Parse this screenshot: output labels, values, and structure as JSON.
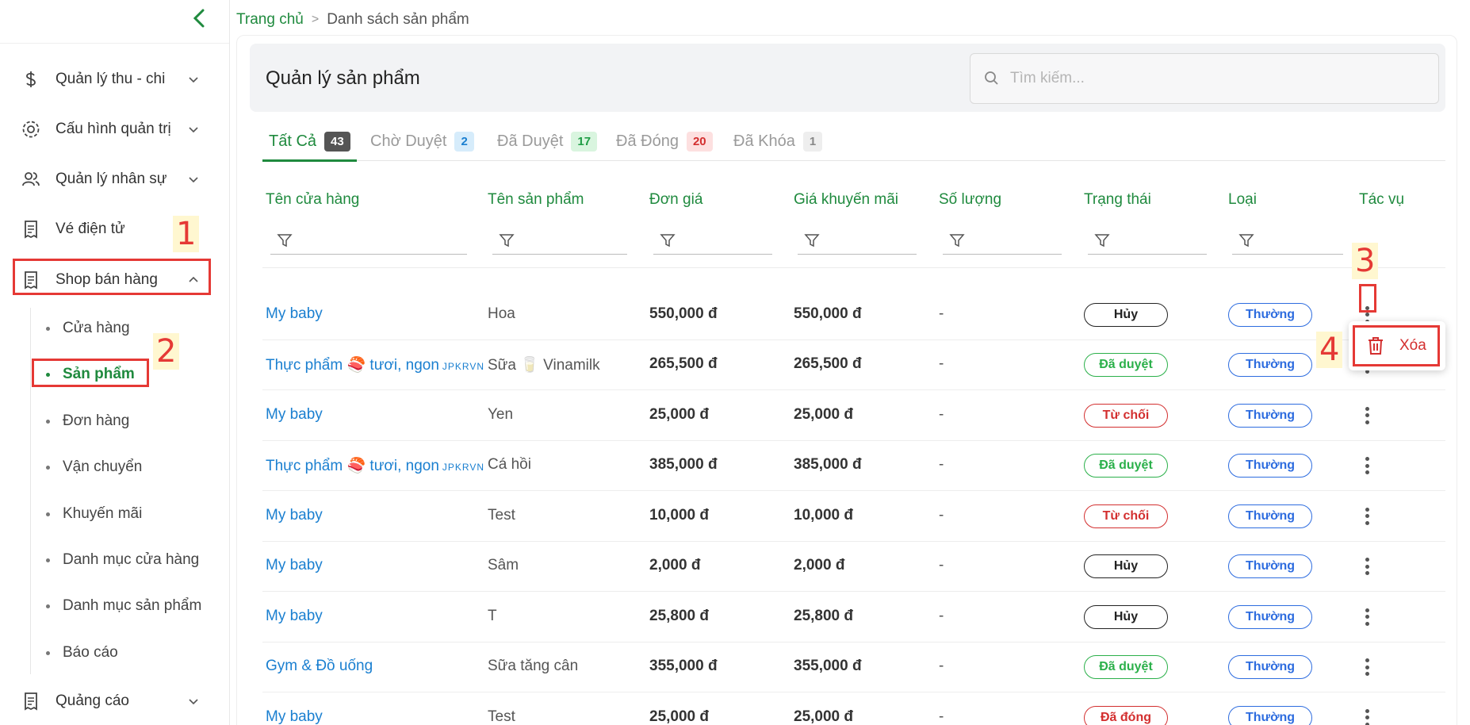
{
  "sidebar": {
    "items": [
      {
        "label": "Quản lý thu - chi",
        "icon": "dollar-icon"
      },
      {
        "label": "Cấu hình quản trị",
        "icon": "gear-icon"
      },
      {
        "label": "Quản lý nhân sự",
        "icon": "users-icon"
      },
      {
        "label": "Vé điện tử",
        "icon": "receipt-icon"
      },
      {
        "label": "Shop bán hàng",
        "icon": "receipt-icon"
      },
      {
        "label": "Quảng cáo",
        "icon": "receipt-icon"
      }
    ],
    "sub_items": [
      "Cửa hàng",
      "Sản phẩm",
      "Đơn hàng",
      "Vận chuyển",
      "Khuyến mãi",
      "Danh mục cửa hàng",
      "Danh mục sản phẩm",
      "Báo cáo"
    ],
    "active_sub": "Sản phẩm"
  },
  "breadcrumb": {
    "home": "Trang chủ",
    "separator": ">",
    "current": "Danh sách sản phẩm"
  },
  "header": {
    "title": "Quản lý sản phẩm",
    "search_placeholder": "Tìm kiếm..."
  },
  "tabs": [
    {
      "label": "Tất Cả",
      "count": "43",
      "active": true,
      "badge_bg": "#555555",
      "badge_fg": "#ffffff"
    },
    {
      "label": "Chờ Duyệt",
      "count": "2",
      "badge_bg": "#d6ecfb",
      "badge_fg": "#1a7fd0"
    },
    {
      "label": "Đã Duyệt",
      "count": "17",
      "badge_bg": "#d9f5df",
      "badge_fg": "#1f9d45"
    },
    {
      "label": "Đã Đóng",
      "count": "20",
      "badge_bg": "#fde0e0",
      "badge_fg": "#d32f2f"
    },
    {
      "label": "Đã Khóa",
      "count": "1",
      "badge_bg": "#eeeeee",
      "badge_fg": "#888888"
    }
  ],
  "columns": [
    "Tên cửa hàng",
    "Tên sản phẩm",
    "Đơn giá",
    "Giá khuyến mãi",
    "Số lượng",
    "Trạng thái",
    "Loại",
    "Tác vụ"
  ],
  "rows": [
    {
      "shop": "My baby",
      "shop_tag": "",
      "product": "Hoa",
      "price": "550,000 đ",
      "promo": "550,000 đ",
      "qty": "-",
      "status": "Hủy",
      "type": "Thường"
    },
    {
      "shop": "Thực phẩm 🍣 tươi, ngon",
      "shop_tag": "JPKRVN",
      "product": "Sữa 🥛 Vinamilk",
      "price": "265,500 đ",
      "promo": "265,500 đ",
      "qty": "-",
      "status": "Đã duyệt",
      "type": "Thường"
    },
    {
      "shop": "My baby",
      "shop_tag": "",
      "product": "Yen",
      "price": "25,000 đ",
      "promo": "25,000 đ",
      "qty": "-",
      "status": "Từ chối",
      "type": "Thường"
    },
    {
      "shop": "Thực phẩm 🍣 tươi, ngon",
      "shop_tag": "JPKRVN",
      "product": "Cá hồi",
      "price": "385,000 đ",
      "promo": "385,000 đ",
      "qty": "-",
      "status": "Đã duyệt",
      "type": "Thường"
    },
    {
      "shop": "My baby",
      "shop_tag": "",
      "product": "Test",
      "price": "10,000 đ",
      "promo": "10,000 đ",
      "qty": "-",
      "status": "Từ chối",
      "type": "Thường"
    },
    {
      "shop": "My baby",
      "shop_tag": "",
      "product": "Sâm",
      "price": "2,000 đ",
      "promo": "2,000 đ",
      "qty": "-",
      "status": "Hủy",
      "type": "Thường"
    },
    {
      "shop": "My baby",
      "shop_tag": "",
      "product": "T",
      "price": "25,800 đ",
      "promo": "25,800 đ",
      "qty": "-",
      "status": "Hủy",
      "type": "Thường"
    },
    {
      "shop": "Gym & Đồ uống",
      "shop_tag": "",
      "product": "Sữa tăng cân",
      "price": "355,000 đ",
      "promo": "355,000 đ",
      "qty": "-",
      "status": "Đã duyệt",
      "type": "Thường"
    },
    {
      "shop": "My baby",
      "shop_tag": "",
      "product": "Test",
      "price": "25,000 đ",
      "promo": "25,000 đ",
      "qty": "-",
      "status": "Đã đóng",
      "type": "Thường"
    }
  ],
  "status_colors": {
    "Hủy": "#222222",
    "Đã duyệt": "#2bb04a",
    "Từ chối": "#d32f2f",
    "Đã đóng": "#d32f2f"
  },
  "action_menu": {
    "delete_label": "Xóa"
  },
  "annotations": [
    "1",
    "2",
    "3",
    "4"
  ],
  "colors": {
    "accent": "#1f8a3e",
    "link": "#1a7fd0",
    "annotation": "#e53935"
  }
}
